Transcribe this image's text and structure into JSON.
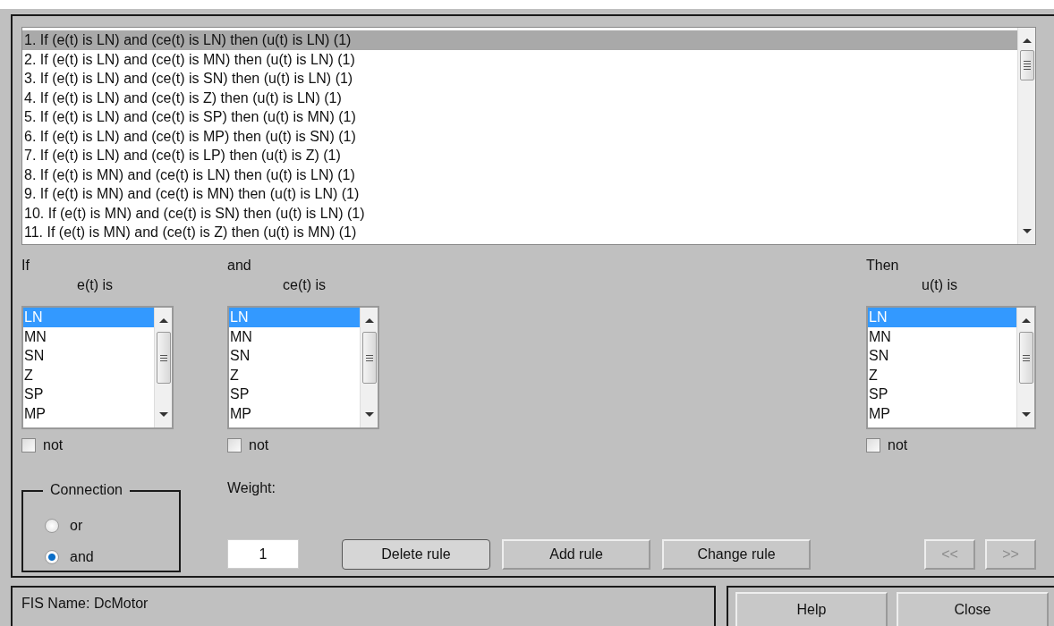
{
  "rules": [
    {
      "text": "1. If (e(t) is LN) and (ce(t) is LN) then (u(t) is LN) (1)",
      "selected": true
    },
    {
      "text": "2. If (e(t) is LN) and (ce(t) is MN) then (u(t) is LN) (1)",
      "selected": false
    },
    {
      "text": "3. If (e(t) is LN) and (ce(t) is SN) then (u(t) is LN) (1)",
      "selected": false
    },
    {
      "text": "4. If (e(t) is LN) and (ce(t) is Z) then (u(t) is LN) (1)",
      "selected": false
    },
    {
      "text": "5. If (e(t) is LN) and (ce(t) is SP) then (u(t) is MN) (1)",
      "selected": false
    },
    {
      "text": "6. If (e(t) is LN) and (ce(t) is MP) then (u(t) is SN) (1)",
      "selected": false
    },
    {
      "text": "7. If (e(t) is LN) and (ce(t) is LP) then (u(t) is Z) (1)",
      "selected": false
    },
    {
      "text": "8. If (e(t) is MN) and (ce(t) is LN) then (u(t) is LN) (1)",
      "selected": false
    },
    {
      "text": "9. If (e(t) is MN) and (ce(t) is MN) then (u(t) is LN) (1)",
      "selected": false
    },
    {
      "text": "10. If (e(t) is MN) and (ce(t) is SN) then (u(t) is LN) (1)",
      "selected": false
    },
    {
      "text": "11. If (e(t) is MN) and (ce(t) is Z) then (u(t) is MN) (1)",
      "selected": false
    }
  ],
  "variables": [
    {
      "kind": "input",
      "header": "If",
      "label": "e(t) is",
      "items": [
        {
          "label": "LN",
          "selected": true
        },
        {
          "label": "MN",
          "selected": false
        },
        {
          "label": "SN",
          "selected": false
        },
        {
          "label": "Z",
          "selected": false
        },
        {
          "label": "SP",
          "selected": false
        },
        {
          "label": "MP",
          "selected": false
        }
      ],
      "not": {
        "label": "not",
        "checked": false
      }
    },
    {
      "kind": "input",
      "header": "and",
      "label": "ce(t) is",
      "items": [
        {
          "label": "LN",
          "selected": true
        },
        {
          "label": "MN",
          "selected": false
        },
        {
          "label": "SN",
          "selected": false
        },
        {
          "label": "Z",
          "selected": false
        },
        {
          "label": "SP",
          "selected": false
        },
        {
          "label": "MP",
          "selected": false
        }
      ],
      "not": {
        "label": "not",
        "checked": false
      }
    },
    {
      "kind": "output",
      "header": "Then",
      "label": "u(t) is",
      "items": [
        {
          "label": "LN",
          "selected": true
        },
        {
          "label": "MN",
          "selected": false
        },
        {
          "label": "SN",
          "selected": false
        },
        {
          "label": "Z",
          "selected": false
        },
        {
          "label": "SP",
          "selected": false
        },
        {
          "label": "MP",
          "selected": false
        }
      ],
      "not": {
        "label": "not",
        "checked": false
      }
    }
  ],
  "connection": {
    "title": "Connection",
    "options": [
      {
        "label": "or",
        "selected": false
      },
      {
        "label": "and",
        "selected": true
      }
    ]
  },
  "weight": {
    "label": "Weight:",
    "value": "1"
  },
  "rule_buttons": [
    {
      "label": "Delete rule",
      "disabled": false
    },
    {
      "label": "Add rule",
      "disabled": false
    },
    {
      "label": "Change rule",
      "disabled": false
    }
  ],
  "nav_buttons": [
    {
      "label": "<<",
      "disabled": true
    },
    {
      "label": ">>",
      "disabled": true
    }
  ],
  "status": {
    "text": "FIS Name: DcMotor"
  },
  "footer_buttons": [
    {
      "label": "Help"
    },
    {
      "label": "Close"
    }
  ]
}
